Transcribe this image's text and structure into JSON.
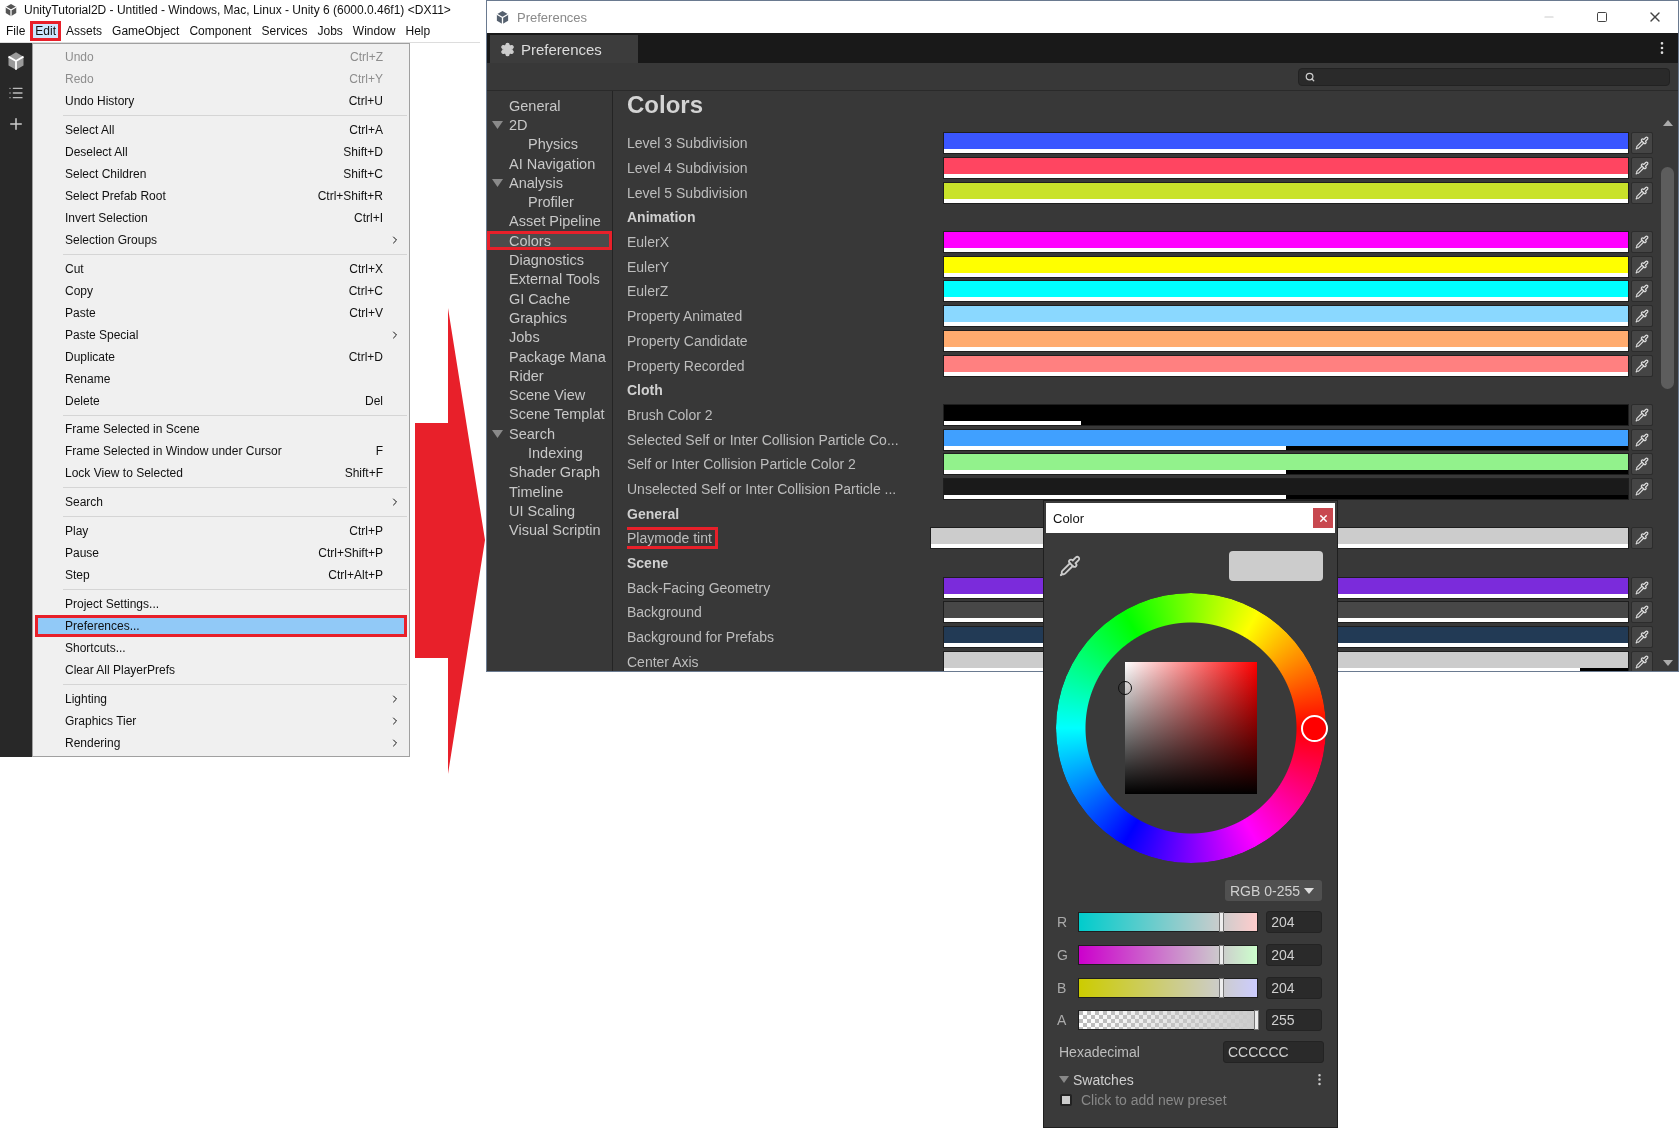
{
  "unity_window": {
    "title": "UnityTutorial2D - Untitled - Windows, Mac, Linux - Unity 6 (6000.0.46f1) <DX11>",
    "menu_bar": [
      {
        "label": "File",
        "selected": false,
        "outlined": false
      },
      {
        "label": "Edit",
        "selected": true,
        "outlined": true
      },
      {
        "label": "Assets",
        "selected": false,
        "outlined": false
      },
      {
        "label": "GameObject",
        "selected": false,
        "outlined": false
      },
      {
        "label": "Component",
        "selected": false,
        "outlined": false
      },
      {
        "label": "Services",
        "selected": false,
        "outlined": false
      },
      {
        "label": "Jobs",
        "selected": false,
        "outlined": false
      },
      {
        "label": "Window",
        "selected": false,
        "outlined": false
      },
      {
        "label": "Help",
        "selected": false,
        "outlined": false
      }
    ],
    "edit_menu": {
      "groups": [
        [
          {
            "label": "Undo",
            "shortcut": "Ctrl+Z",
            "disabled": true,
            "selected": false,
            "submenu": false,
            "outlined": false
          },
          {
            "label": "Redo",
            "shortcut": "Ctrl+Y",
            "disabled": true,
            "selected": false,
            "submenu": false,
            "outlined": false
          },
          {
            "label": "Undo History",
            "shortcut": "Ctrl+U",
            "disabled": false,
            "selected": false,
            "submenu": false,
            "outlined": false
          }
        ],
        [
          {
            "label": "Select All",
            "shortcut": "Ctrl+A",
            "disabled": false,
            "selected": false,
            "submenu": false,
            "outlined": false
          },
          {
            "label": "Deselect All",
            "shortcut": "Shift+D",
            "disabled": false,
            "selected": false,
            "submenu": false,
            "outlined": false
          },
          {
            "label": "Select Children",
            "shortcut": "Shift+C",
            "disabled": false,
            "selected": false,
            "submenu": false,
            "outlined": false
          },
          {
            "label": "Select Prefab Root",
            "shortcut": "Ctrl+Shift+R",
            "disabled": false,
            "selected": false,
            "submenu": false,
            "outlined": false
          },
          {
            "label": "Invert Selection",
            "shortcut": "Ctrl+I",
            "disabled": false,
            "selected": false,
            "submenu": false,
            "outlined": false
          },
          {
            "label": "Selection Groups",
            "disabled": false,
            "selected": false,
            "submenu": true,
            "outlined": false
          }
        ],
        [
          {
            "label": "Cut",
            "shortcut": "Ctrl+X",
            "disabled": false,
            "selected": false,
            "submenu": false,
            "outlined": false
          },
          {
            "label": "Copy",
            "shortcut": "Ctrl+C",
            "disabled": false,
            "selected": false,
            "submenu": false,
            "outlined": false
          },
          {
            "label": "Paste",
            "shortcut": "Ctrl+V",
            "disabled": false,
            "selected": false,
            "submenu": false,
            "outlined": false
          },
          {
            "label": "Paste Special",
            "disabled": false,
            "selected": false,
            "submenu": true,
            "outlined": false
          },
          {
            "label": "Duplicate",
            "shortcut": "Ctrl+D",
            "disabled": false,
            "selected": false,
            "submenu": false,
            "outlined": false
          },
          {
            "label": "Rename",
            "disabled": false,
            "selected": false,
            "submenu": false,
            "outlined": false
          },
          {
            "label": "Delete",
            "shortcut": "Del",
            "disabled": false,
            "selected": false,
            "submenu": false,
            "outlined": false
          }
        ],
        [
          {
            "label": "Frame Selected in Scene",
            "disabled": false,
            "selected": false,
            "submenu": false,
            "outlined": false
          },
          {
            "label": "Frame Selected in Window under Cursor",
            "shortcut": "F",
            "disabled": false,
            "selected": false,
            "submenu": false,
            "outlined": false
          },
          {
            "label": "Lock View to Selected",
            "shortcut": "Shift+F",
            "disabled": false,
            "selected": false,
            "submenu": false,
            "outlined": false
          }
        ],
        [
          {
            "label": "Search",
            "disabled": false,
            "selected": false,
            "submenu": true,
            "outlined": false
          }
        ],
        [
          {
            "label": "Play",
            "shortcut": "Ctrl+P",
            "disabled": false,
            "selected": false,
            "submenu": false,
            "outlined": false
          },
          {
            "label": "Pause",
            "shortcut": "Ctrl+Shift+P",
            "disabled": false,
            "selected": false,
            "submenu": false,
            "outlined": false
          },
          {
            "label": "Step",
            "shortcut": "Ctrl+Alt+P",
            "disabled": false,
            "selected": false,
            "submenu": false,
            "outlined": false
          }
        ],
        [
          {
            "label": "Project Settings...",
            "disabled": false,
            "selected": false,
            "submenu": false,
            "outlined": false
          },
          {
            "label": "Preferences...",
            "disabled": false,
            "selected": true,
            "submenu": false,
            "outlined": true
          },
          {
            "label": "Shortcuts...",
            "disabled": false,
            "selected": false,
            "submenu": false,
            "outlined": false
          },
          {
            "label": "Clear All PlayerPrefs",
            "disabled": false,
            "selected": false,
            "submenu": false,
            "outlined": false
          }
        ],
        [
          {
            "label": "Lighting",
            "disabled": false,
            "selected": false,
            "submenu": true,
            "outlined": false
          },
          {
            "label": "Graphics Tier",
            "disabled": false,
            "selected": false,
            "submenu": true,
            "outlined": false
          },
          {
            "label": "Rendering",
            "disabled": false,
            "selected": false,
            "submenu": true,
            "outlined": false
          }
        ]
      ]
    }
  },
  "preferences_window": {
    "title": "Preferences",
    "tab": "Preferences",
    "sidebar": [
      {
        "label": "General",
        "selected": false,
        "outlined": false
      },
      {
        "label": "2D",
        "selected": false,
        "outlined": false,
        "expanded": true,
        "children": [
          {
            "label": "Physics",
            "selected": false,
            "outlined": false
          }
        ]
      },
      {
        "label": "AI Navigation",
        "selected": false,
        "outlined": false
      },
      {
        "label": "Analysis",
        "selected": false,
        "outlined": false,
        "expanded": true,
        "children": [
          {
            "label": "Profiler",
            "selected": false,
            "outlined": false
          }
        ]
      },
      {
        "label": "Asset Pipeline",
        "selected": false,
        "outlined": false
      },
      {
        "label": "Colors",
        "selected": true,
        "outlined": true
      },
      {
        "label": "Diagnostics",
        "selected": false,
        "outlined": false
      },
      {
        "label": "External Tools",
        "selected": false,
        "outlined": false
      },
      {
        "label": "GI Cache",
        "selected": false,
        "outlined": false
      },
      {
        "label": "Graphics",
        "selected": false,
        "outlined": false
      },
      {
        "label": "Jobs",
        "selected": false,
        "outlined": false
      },
      {
        "label": "Package Mana",
        "selected": false,
        "outlined": false
      },
      {
        "label": "Rider",
        "selected": false,
        "outlined": false
      },
      {
        "label": "Scene View",
        "selected": false,
        "outlined": false
      },
      {
        "label": "Scene Templat",
        "selected": false,
        "outlined": false
      },
      {
        "label": "Search",
        "selected": false,
        "outlined": false,
        "expanded": true,
        "children": [
          {
            "label": "Indexing",
            "selected": false,
            "outlined": false
          }
        ]
      },
      {
        "label": "Shader Graph",
        "selected": false,
        "outlined": false
      },
      {
        "label": "Timeline",
        "selected": false,
        "outlined": false
      },
      {
        "label": "UI Scaling",
        "selected": false,
        "outlined": false
      },
      {
        "label": "Visual Scriptin",
        "selected": false,
        "outlined": false
      }
    ],
    "content": {
      "heading": "Colors",
      "rows": [
        {
          "kind": "color",
          "label": "Level 3 Subdivision",
          "color": "#3a56ff",
          "level": 1,
          "outlined": false
        },
        {
          "kind": "color",
          "label": "Level 4 Subdivision",
          "color": "#ff4561",
          "level": 1,
          "outlined": false
        },
        {
          "kind": "color",
          "label": "Level 5 Subdivision",
          "color": "#c9e22a",
          "level": 1,
          "outlined": false
        },
        {
          "kind": "header",
          "label": "Animation"
        },
        {
          "kind": "color",
          "label": "EulerX",
          "color": "#ff00ff",
          "level": 1,
          "outlined": false
        },
        {
          "kind": "color",
          "label": "EulerY",
          "color": "#ffff00",
          "level": 1,
          "outlined": false
        },
        {
          "kind": "color",
          "label": "EulerZ",
          "color": "#00ffff",
          "level": 1,
          "outlined": false
        },
        {
          "kind": "color",
          "label": "Property Animated",
          "color": "#8ad8ff",
          "level": 1,
          "outlined": false
        },
        {
          "kind": "color",
          "label": "Property Candidate",
          "color": "#ffab6e",
          "level": 1,
          "outlined": false
        },
        {
          "kind": "color",
          "label": "Property Recorded",
          "color": "#ff8080",
          "level": 1,
          "outlined": false
        },
        {
          "kind": "header",
          "label": "Cloth"
        },
        {
          "kind": "color",
          "label": "Brush Color 2",
          "color": "#000000",
          "level": 0.2,
          "outlined": false
        },
        {
          "kind": "color",
          "label": "Selected Self or Inter Collision Particle Co...",
          "color": "#40a0ff",
          "level": 0.5,
          "outlined": false
        },
        {
          "kind": "color",
          "label": "Self or Inter Collision Particle Color 2",
          "color": "#92f28c",
          "level": 0.5,
          "outlined": false
        },
        {
          "kind": "color",
          "label": "Unselected Self or Inter Collision Particle ...",
          "color": "#1a1a1a",
          "level": 0.5,
          "outlined": false
        },
        {
          "kind": "header",
          "label": "General"
        },
        {
          "kind": "color",
          "label": "Playmode tint",
          "color": "#cccccc",
          "level": 1,
          "outlined": true
        },
        {
          "kind": "header",
          "label": "Scene"
        },
        {
          "kind": "color",
          "label": "Back-Facing Geometry",
          "color": "#7b2bdb",
          "level": 1,
          "outlined": false
        },
        {
          "kind": "color",
          "label": "Background",
          "color": "#474747",
          "level": 1,
          "outlined": false
        },
        {
          "kind": "color",
          "label": "Background for Prefabs",
          "color": "#223a55",
          "level": 1,
          "outlined": false
        },
        {
          "kind": "color",
          "label": "Center Axis",
          "color": "#cccccc",
          "level": 0.93,
          "outlined": false
        }
      ]
    }
  },
  "color_picker": {
    "title": "Color",
    "mode": "RGB 0-255",
    "channels": [
      {
        "kind": "red",
        "label": "R",
        "value": "204",
        "level": 0.8
      },
      {
        "kind": "green",
        "label": "G",
        "value": "204",
        "level": 0.8
      },
      {
        "kind": "blue",
        "label": "B",
        "value": "204",
        "level": 0.8
      },
      {
        "kind": "alpha",
        "label": "A",
        "value": "255",
        "level": 1
      }
    ],
    "hex_label": "Hexadecimal",
    "hex": "CCCCCC",
    "swatches": {
      "label": "Swatches",
      "expanded": true,
      "placeholder": "Click to add new preset"
    }
  }
}
